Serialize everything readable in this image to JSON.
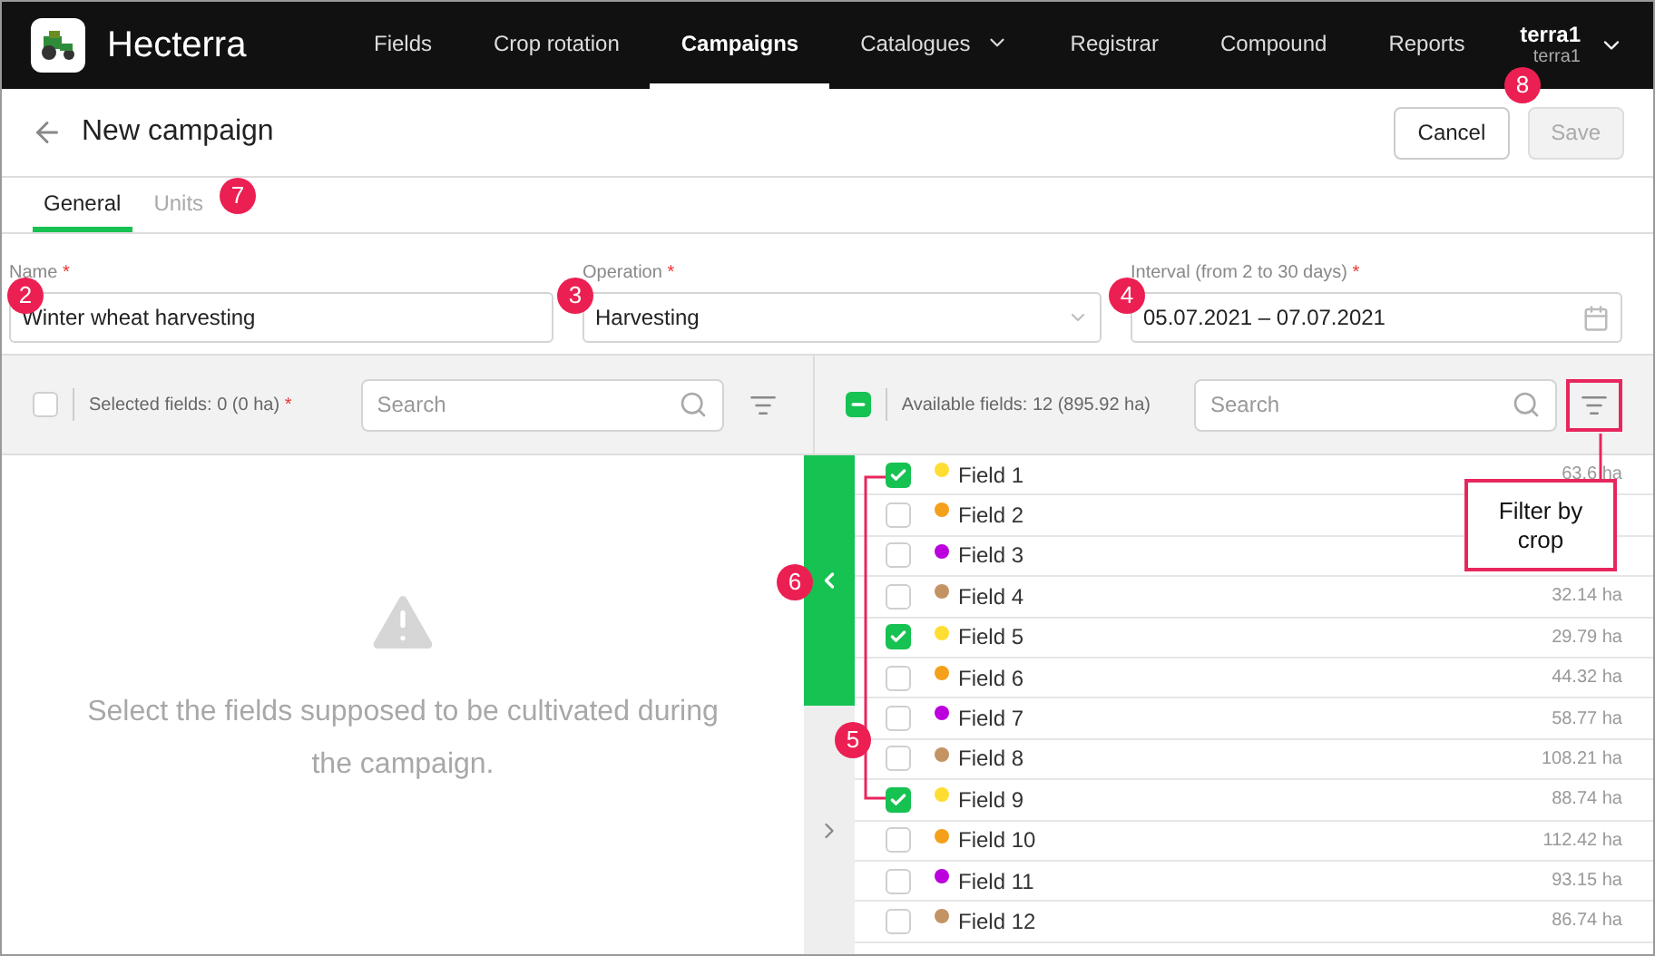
{
  "app": {
    "name": "Hecterra"
  },
  "nav": [
    {
      "label": "Fields",
      "selected": false,
      "dropdown": false
    },
    {
      "label": "Crop rotation",
      "selected": false,
      "dropdown": false
    },
    {
      "label": "Campaigns",
      "selected": true,
      "dropdown": false
    },
    {
      "label": "Catalogues",
      "selected": false,
      "dropdown": true
    },
    {
      "label": "Registrar",
      "selected": false,
      "dropdown": false
    },
    {
      "label": "Compound",
      "selected": false,
      "dropdown": false
    },
    {
      "label": "Reports",
      "selected": false,
      "dropdown": false
    }
  ],
  "user": {
    "name": "terra1",
    "account": "terra1"
  },
  "page": {
    "title": "New campaign",
    "buttons": [
      {
        "label": "Cancel",
        "disabled": false
      },
      {
        "label": "Save",
        "disabled": true
      }
    ]
  },
  "tabs": [
    {
      "label": "General",
      "selected": true
    },
    {
      "label": "Units",
      "selected": false
    }
  ],
  "form": {
    "name": {
      "label": "Name",
      "required_mark": "*",
      "value": "Winter wheat harvesting"
    },
    "operation": {
      "label": "Operation",
      "required_mark": "*",
      "value": "Harvesting"
    },
    "interval": {
      "label": "Interval (from 2 to 30 days)",
      "required_mark": "*",
      "value": "05.07.2021 – 07.07.2021"
    }
  },
  "selected_panel": {
    "checked": false,
    "summary": "Selected fields: 0 (0 ha)",
    "required_mark": "*",
    "search_placeholder": "Search",
    "empty_message": "Select the fields supposed to be cultivated during the campaign."
  },
  "available_panel": {
    "checked": true,
    "indeterminate": true,
    "summary": "Available fields: 12 (895.92 ha)",
    "search_placeholder": "Search"
  },
  "fields": [
    {
      "name": "Field 1",
      "area": "63.6 ha",
      "checked": true,
      "color": "#ffdd33"
    },
    {
      "name": "Field 2",
      "checked": false,
      "color": "#f5a01a"
    },
    {
      "name": "Field 3",
      "checked": false,
      "color": "#bb00dd"
    },
    {
      "name": "Field 4",
      "area": "32.14 ha",
      "checked": false,
      "color": "#c49364"
    },
    {
      "name": "Field 5",
      "area": "29.79 ha",
      "checked": true,
      "color": "#ffdd33"
    },
    {
      "name": "Field 6",
      "area": "44.32 ha",
      "checked": false,
      "color": "#f5a01a"
    },
    {
      "name": "Field 7",
      "area": "58.77 ha",
      "checked": false,
      "color": "#bb00dd"
    },
    {
      "name": "Field 8",
      "area": "108.21 ha",
      "checked": false,
      "color": "#c49364"
    },
    {
      "name": "Field 9",
      "area": "88.74 ha",
      "checked": true,
      "color": "#ffdd33"
    },
    {
      "name": "Field 10",
      "area": "112.42 ha",
      "checked": false,
      "color": "#f5a01a"
    },
    {
      "name": "Field 11",
      "area": "93.15 ha",
      "checked": false,
      "color": "#bb00dd"
    },
    {
      "name": "Field 12",
      "area": "86.74 ha",
      "checked": false,
      "color": "#c49364"
    }
  ],
  "annotations": [
    {
      "label": "2"
    },
    {
      "label": "3"
    },
    {
      "label": "4"
    },
    {
      "label": "5"
    },
    {
      "label": "6"
    },
    {
      "label": "7"
    },
    {
      "label": "8"
    }
  ],
  "callout": {
    "text": "Filter by crop"
  }
}
